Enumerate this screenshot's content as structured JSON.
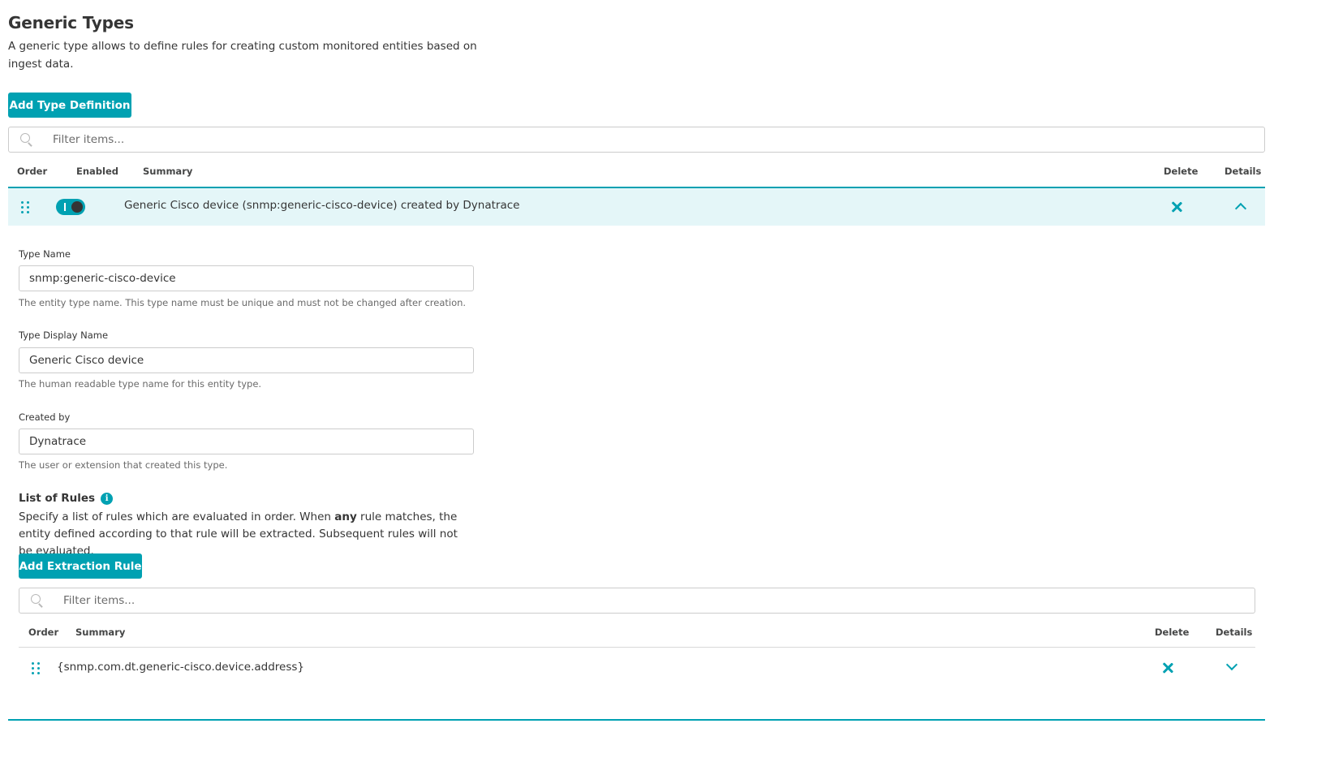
{
  "page": {
    "title": "Generic Types",
    "description": "A generic type allows to define rules for creating custom monitored entities based on ingest data."
  },
  "toolbar": {
    "add_type_label": "Add Type Definition"
  },
  "filter": {
    "placeholder": "Filter items..."
  },
  "table": {
    "columns": {
      "order": "Order",
      "enabled": "Enabled",
      "summary": "Summary",
      "delete": "Delete",
      "details": "Details"
    },
    "rows": [
      {
        "summary": "Generic Cisco device (snmp:generic-cisco-device) created by Dynatrace",
        "enabled": true,
        "expanded": true
      }
    ]
  },
  "details": {
    "type_name": {
      "label": "Type Name",
      "value": "snmp:generic-cisco-device",
      "hint": "The entity type name. This type name must be unique and must not be changed after creation."
    },
    "display_name": {
      "label": "Type Display Name",
      "value": "Generic Cisco device",
      "hint": "The human readable type name for this entity type."
    },
    "created_by": {
      "label": "Created by",
      "value": "Dynatrace",
      "hint": "The user or extension that created this type."
    },
    "rules": {
      "title": "List of Rules",
      "info_icon": "info-icon",
      "desc_before": "Specify a list of rules which are evaluated in order. When ",
      "desc_bold": "any",
      "desc_after": " rule matches, the entity defined according to that rule will be extracted. Subsequent rules will not be evaluated.",
      "add_rule_label": "Add Extraction Rule",
      "filter_placeholder": "Filter items...",
      "columns": {
        "order": "Order",
        "summary": "Summary",
        "delete": "Delete",
        "details": "Details"
      },
      "rows": [
        {
          "summary": "{snmp.com.dt.generic-cisco.device.address}"
        }
      ]
    }
  },
  "colors": {
    "accent": "#00a1b2",
    "row_highlight": "#e4f6f8",
    "text": "#353535"
  }
}
